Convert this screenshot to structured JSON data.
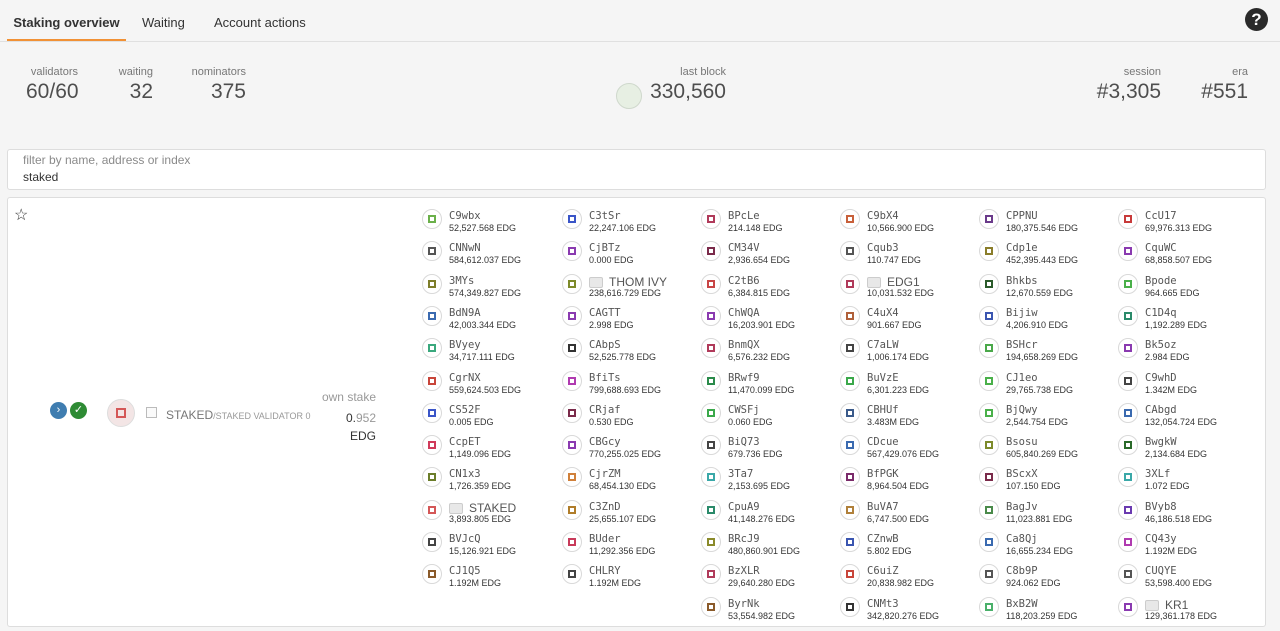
{
  "tabs": [
    "Staking overview",
    "Waiting",
    "Account actions"
  ],
  "help_icon": "?",
  "summary": {
    "validators": {
      "label": "validators",
      "value": "60/60"
    },
    "waiting": {
      "label": "waiting",
      "value": "32"
    },
    "nominators": {
      "label": "nominators",
      "value": "375"
    },
    "last_block": {
      "label": "last block",
      "value": "330,560"
    },
    "session": {
      "label": "session",
      "value": "#3,305"
    },
    "era": {
      "label": "era",
      "value": "#551"
    }
  },
  "filter": {
    "placeholder": "filter by name, address or index",
    "value": "staked"
  },
  "validator": {
    "name": "STAKED",
    "sub_name": "/STAKED VALIDATOR 0",
    "own_stake_label": "own stake",
    "own_stake_prefix": "0.",
    "own_stake_value": "952",
    "own_stake_unit": "EDG"
  },
  "nominator_columns": [
    [
      {
        "name": "C9wbx",
        "balance": "52,527.568 EDG",
        "color": "#6bb04a"
      },
      {
        "name": "CNNwN",
        "balance": "584,612.037 EDG",
        "color": "#555555"
      },
      {
        "name": "3MYs",
        "balance": "574,349.827 EDG",
        "color": "#7d7d2a"
      },
      {
        "name": "BdN9A",
        "balance": "42,003.344 EDG",
        "color": "#3a6ab0"
      },
      {
        "name": "BVyey",
        "balance": "34,717.111 EDG",
        "color": "#3aa87d"
      },
      {
        "name": "CgrNX",
        "balance": "559,624.503 EDG",
        "color": "#c8453a"
      },
      {
        "name": "CS52F",
        "balance": "0.005 EDG",
        "color": "#3a55c8"
      },
      {
        "name": "CcpET",
        "balance": "1,149.096 EDG",
        "color": "#d03a5a"
      },
      {
        "name": "CN1x3",
        "balance": "1,726.359 EDG",
        "color": "#6b7d2a"
      },
      {
        "name": "STAKED",
        "balance": "3,893.805 EDG",
        "color": "#d45757",
        "plain": true
      },
      {
        "name": "BVJcQ",
        "balance": "15,126.921 EDG",
        "color": "#444444"
      },
      {
        "name": "CJ1Q5",
        "balance": "1.192M EDG",
        "color": "#8a5a2a"
      }
    ],
    [
      {
        "name": "C3tSr",
        "balance": "22,247.106 EDG",
        "color": "#3a55c8"
      },
      {
        "name": "CjBTz",
        "balance": "0.000 EDG",
        "color": "#8a3ab0"
      },
      {
        "name": "THOM IVY",
        "balance": "238,616.729 EDG",
        "color": "#7d8a2a",
        "plain": true
      },
      {
        "name": "CAGTT",
        "balance": "2.998 EDG",
        "color": "#8a3ab0"
      },
      {
        "name": "CAbpS",
        "balance": "52,525.778 EDG",
        "color": "#333333"
      },
      {
        "name": "BfiTs",
        "balance": "799,688.693 EDG",
        "color": "#b03ab0"
      },
      {
        "name": "CRjaf",
        "balance": "0.530 EDG",
        "color": "#7a2a4a"
      },
      {
        "name": "CBGcy",
        "balance": "770,255.025 EDG",
        "color": "#8a3ab0"
      },
      {
        "name": "CjrZM",
        "balance": "68,454.130 EDG",
        "color": "#d0803a"
      },
      {
        "name": "C3ZnD",
        "balance": "25,655.107 EDG",
        "color": "#b07d2a"
      },
      {
        "name": "BUder",
        "balance": "11,292.356 EDG",
        "color": "#c83a5a"
      },
      {
        "name": "CHLRY",
        "balance": "1.192M EDG",
        "color": "#444444"
      }
    ],
    [
      {
        "name": "BPcLe",
        "balance": "214.148 EDG",
        "color": "#b03a5a"
      },
      {
        "name": "CM34V",
        "balance": "2,936.654 EDG",
        "color": "#7a2a4a"
      },
      {
        "name": "C2tB6",
        "balance": "6,384.815 EDG",
        "color": "#c84545"
      },
      {
        "name": "ChWQA",
        "balance": "16,203.901 EDG",
        "color": "#8a3ab0"
      },
      {
        "name": "BnmQX",
        "balance": "6,576.232 EDG",
        "color": "#b03a5a"
      },
      {
        "name": "BRwf9",
        "balance": "11,470.099 EDG",
        "color": "#2a8a4a"
      },
      {
        "name": "CWSFj",
        "balance": "0.060 EDG",
        "color": "#3aa84a"
      },
      {
        "name": "BiQ73",
        "balance": "679.736 EDG",
        "color": "#444444"
      },
      {
        "name": "3Ta7",
        "balance": "2,153.695 EDG",
        "color": "#3aa8a8"
      },
      {
        "name": "CpuA9",
        "balance": "41,148.276 EDG",
        "color": "#2a8a6a"
      },
      {
        "name": "BRcJ9",
        "balance": "480,860.901 EDG",
        "color": "#8a8a2a"
      },
      {
        "name": "BzXLR",
        "balance": "29,640.280 EDG",
        "color": "#b03a5a"
      },
      {
        "name": "ByrNk",
        "balance": "53,554.982 EDG",
        "color": "#8a5a2a"
      }
    ],
    [
      {
        "name": "C9bX4",
        "balance": "10,566.900 EDG",
        "color": "#c8603a"
      },
      {
        "name": "Cqub3",
        "balance": "110.747 EDG",
        "color": "#555555"
      },
      {
        "name": "EDG1",
        "balance": "10,031.532 EDG",
        "color": "#b03a5a",
        "plain": true
      },
      {
        "name": "C4uX4",
        "balance": "901.667 EDG",
        "color": "#b0603a"
      },
      {
        "name": "C7aLW",
        "balance": "1,006.174 EDG",
        "color": "#444444"
      },
      {
        "name": "BuVzE",
        "balance": "6,301.223 EDG",
        "color": "#3aa84a"
      },
      {
        "name": "CBHUf",
        "balance": "3.483M EDG",
        "color": "#3a5a8a"
      },
      {
        "name": "CDcue",
        "balance": "567,429.076 EDG",
        "color": "#3a6ab0"
      },
      {
        "name": "BfPGK",
        "balance": "8,964.504 EDG",
        "color": "#7a2a6a"
      },
      {
        "name": "BuVA7",
        "balance": "6,747.500 EDG",
        "color": "#b0803a"
      },
      {
        "name": "CZnwB",
        "balance": "5.802 EDG",
        "color": "#3a55b0"
      },
      {
        "name": "C6uiZ",
        "balance": "20,838.982 EDG",
        "color": "#c8453a"
      },
      {
        "name": "CNMt3",
        "balance": "342,820.276 EDG",
        "color": "#333333"
      }
    ],
    [
      {
        "name": "CPPNU",
        "balance": "180,375.546 EDG",
        "color": "#6a3a8a"
      },
      {
        "name": "Cdp1e",
        "balance": "452,395.443 EDG",
        "color": "#8a7d2a"
      },
      {
        "name": "Bhkbs",
        "balance": "12,670.559 EDG",
        "color": "#2a5a2a"
      },
      {
        "name": "Bijiw",
        "balance": "4,206.910 EDG",
        "color": "#3a55b0"
      },
      {
        "name": "BSHcr",
        "balance": "194,658.269 EDG",
        "color": "#4aa84a"
      },
      {
        "name": "CJ1eo",
        "balance": "29,765.738 EDG",
        "color": "#4ab04a"
      },
      {
        "name": "BjQwy",
        "balance": "2,544.754 EDG",
        "color": "#4ab04a"
      },
      {
        "name": "Bsosu",
        "balance": "605,840.269 EDG",
        "color": "#7d8a2a"
      },
      {
        "name": "BScxX",
        "balance": "107.150 EDG",
        "color": "#7a2a4a"
      },
      {
        "name": "BagJv",
        "balance": "11,023.881 EDG",
        "color": "#4a8a4a"
      },
      {
        "name": "Ca8Qj",
        "balance": "16,655.234 EDG",
        "color": "#3a6ab0"
      },
      {
        "name": "C8b9P",
        "balance": "924.062 EDG",
        "color": "#555555"
      },
      {
        "name": "BxB2W",
        "balance": "118,203.259 EDG",
        "color": "#4ab06a"
      }
    ],
    [
      {
        "name": "CcU17",
        "balance": "69,976.313 EDG",
        "color": "#c83a3a"
      },
      {
        "name": "CquWC",
        "balance": "68,858.507 EDG",
        "color": "#8a3ab0"
      },
      {
        "name": "Bpode",
        "balance": "964.665 EDG",
        "color": "#4ab04a"
      },
      {
        "name": "C1D4q",
        "balance": "1,192.289 EDG",
        "color": "#2a8a6a"
      },
      {
        "name": "Bk5oz",
        "balance": "2.984 EDG",
        "color": "#8a3ab0"
      },
      {
        "name": "C9whD",
        "balance": "1.342M EDG",
        "color": "#444444"
      },
      {
        "name": "CAbgd",
        "balance": "132,054.724 EDG",
        "color": "#3a6ab0"
      },
      {
        "name": "BwgkW",
        "balance": "2,134.684 EDG",
        "color": "#2a6a2a"
      },
      {
        "name": "3XLf",
        "balance": "1.072 EDG",
        "color": "#3aa8a8"
      },
      {
        "name": "BVyb8",
        "balance": "46,186.518 EDG",
        "color": "#6a3ab0"
      },
      {
        "name": "CQ43y",
        "balance": "1.192M EDG",
        "color": "#b03ab0"
      },
      {
        "name": "CUQYE",
        "balance": "53,598.400 EDG",
        "color": "#555555"
      },
      {
        "name": "KR1",
        "balance": "129,361.178 EDG",
        "color": "#8a3ab0",
        "plain": true
      }
    ]
  ]
}
